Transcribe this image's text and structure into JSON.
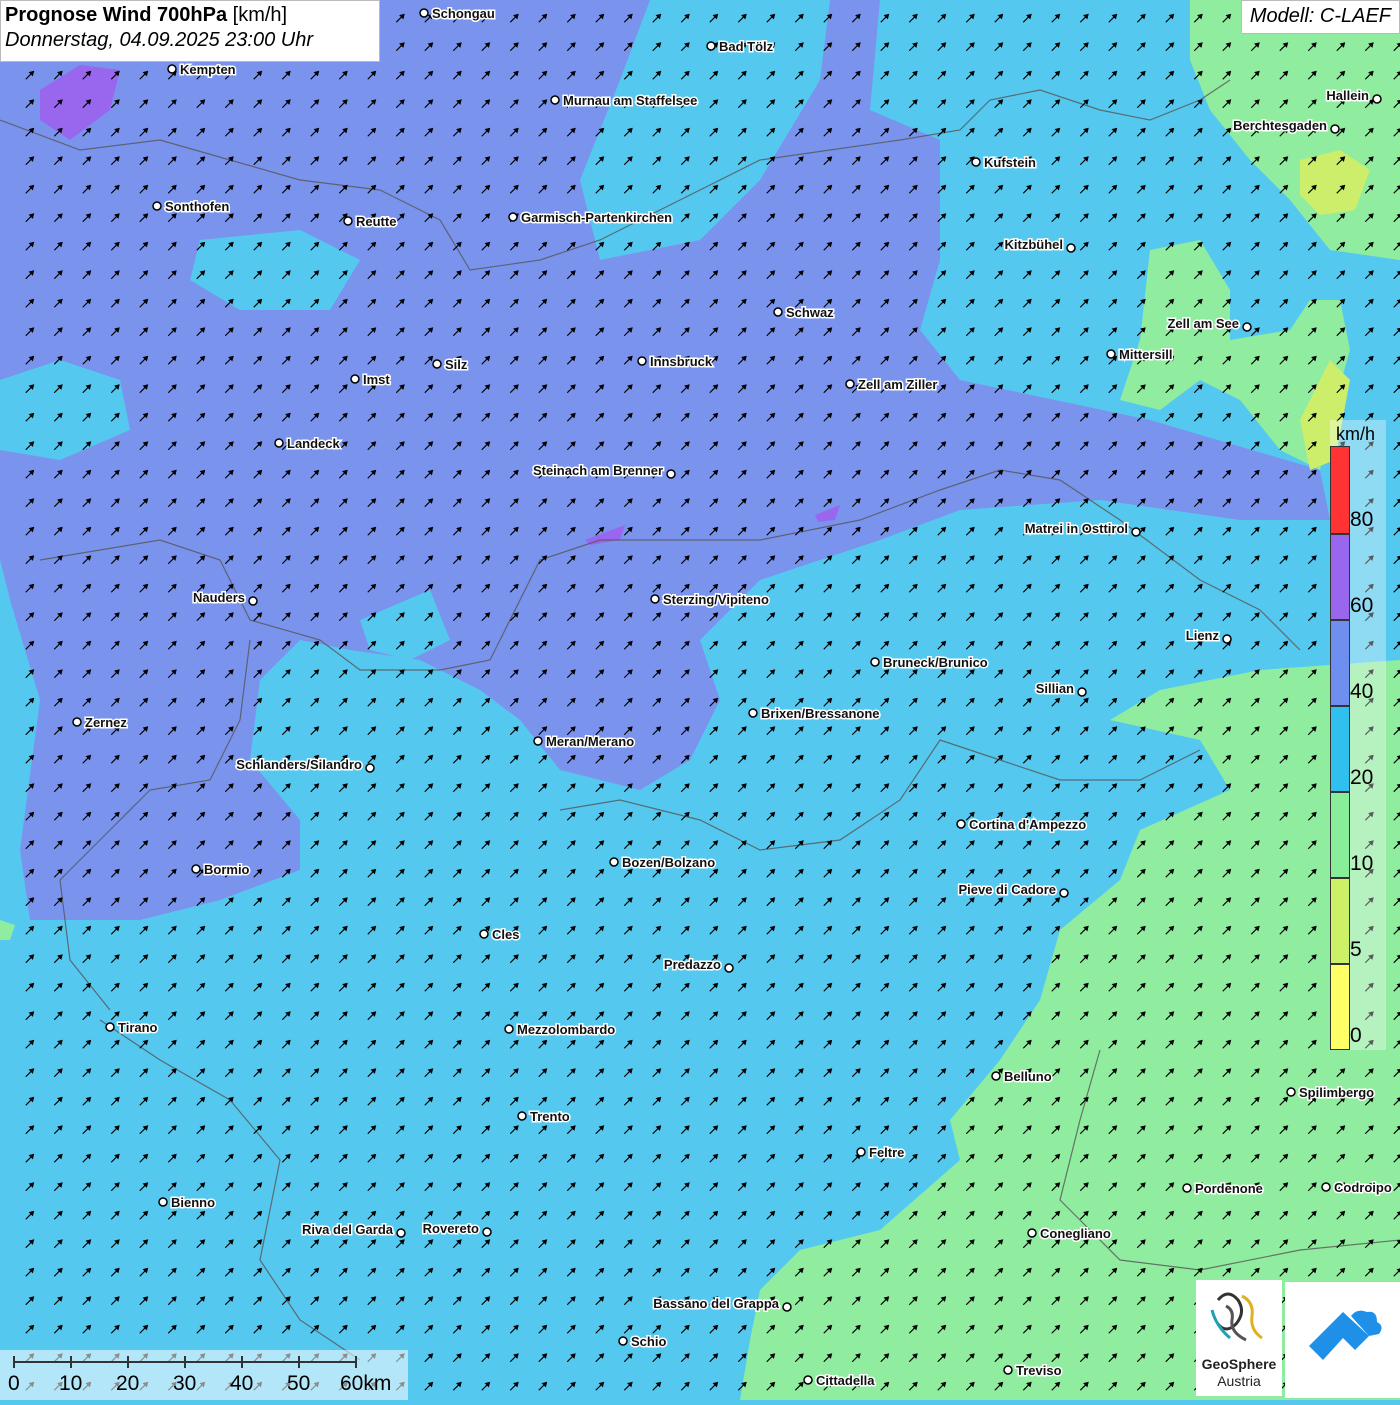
{
  "title": {
    "bold": "Prognose Wind 700hPa",
    "unit": "[km/h]",
    "datetime": "Donnerstag, 04.09.2025 23:00 Uhr"
  },
  "model_label": "Modell: C-LAEF",
  "legend": {
    "unit": "km/h",
    "labels": [
      "80",
      "60",
      "40",
      "20",
      "10",
      "5",
      "0"
    ],
    "colors": {
      "80_plus": "#ff3333",
      "60_80": "#9966ee",
      "40_60": "#6f8ff0",
      "20_40": "#2fc0f0",
      "10_20": "#88ee99",
      "5_10": "#ccf066",
      "0_5": "#ffff66"
    }
  },
  "map": {
    "wind_direction_to": "north-east",
    "cities": [
      {
        "name": "Schongau"
      },
      {
        "name": "Bad Tölz"
      },
      {
        "name": "Kempten"
      },
      {
        "name": "Murnau am Staffelsee"
      },
      {
        "name": "Hallein"
      },
      {
        "name": "Berchtesgaden"
      },
      {
        "name": "Kufstein"
      },
      {
        "name": "Sonthofen"
      },
      {
        "name": "Reutte"
      },
      {
        "name": "Garmisch-Partenkirchen"
      },
      {
        "name": "Kitzbühel"
      },
      {
        "name": "Schwaz"
      },
      {
        "name": "Zell am See"
      },
      {
        "name": "Innsbruck"
      },
      {
        "name": "Mittersill"
      },
      {
        "name": "Imst"
      },
      {
        "name": "Silz"
      },
      {
        "name": "Zell am Ziller"
      },
      {
        "name": "Landeck"
      },
      {
        "name": "Steinach am Brenner"
      },
      {
        "name": "Matrei in Osttirol"
      },
      {
        "name": "Nauders"
      },
      {
        "name": "Sterzing/Vipiteno"
      },
      {
        "name": "Lienz"
      },
      {
        "name": "Bruneck/Brunico"
      },
      {
        "name": "Sillian"
      },
      {
        "name": "Zernez"
      },
      {
        "name": "Brixen/Bressanone"
      },
      {
        "name": "Meran/Merano"
      },
      {
        "name": "Schlanders/Silandro"
      },
      {
        "name": "Cortina d'Ampezzo"
      },
      {
        "name": "Bozen/Bolzano"
      },
      {
        "name": "Bormio"
      },
      {
        "name": "Pieve di Cadore"
      },
      {
        "name": "Cles"
      },
      {
        "name": "Predazzo"
      },
      {
        "name": "Tirano"
      },
      {
        "name": "Mezzolombardo"
      },
      {
        "name": "Belluno"
      },
      {
        "name": "Spilimbergo"
      },
      {
        "name": "Trento"
      },
      {
        "name": "Feltre"
      },
      {
        "name": "Pordenone"
      },
      {
        "name": "Codroipo"
      },
      {
        "name": "Bienno"
      },
      {
        "name": "Riva del Garda"
      },
      {
        "name": "Rovereto"
      },
      {
        "name": "Conegliano"
      },
      {
        "name": "Bassano del Grappa"
      },
      {
        "name": "Schio"
      },
      {
        "name": "Treviso"
      },
      {
        "name": "Cittadella"
      }
    ]
  },
  "scalebar": {
    "labels": [
      "0",
      "10",
      "20",
      "30",
      "40",
      "50",
      "60km"
    ]
  },
  "logos": {
    "geosphere_line1": "GeoSphere",
    "geosphere_line2": "Austria"
  }
}
